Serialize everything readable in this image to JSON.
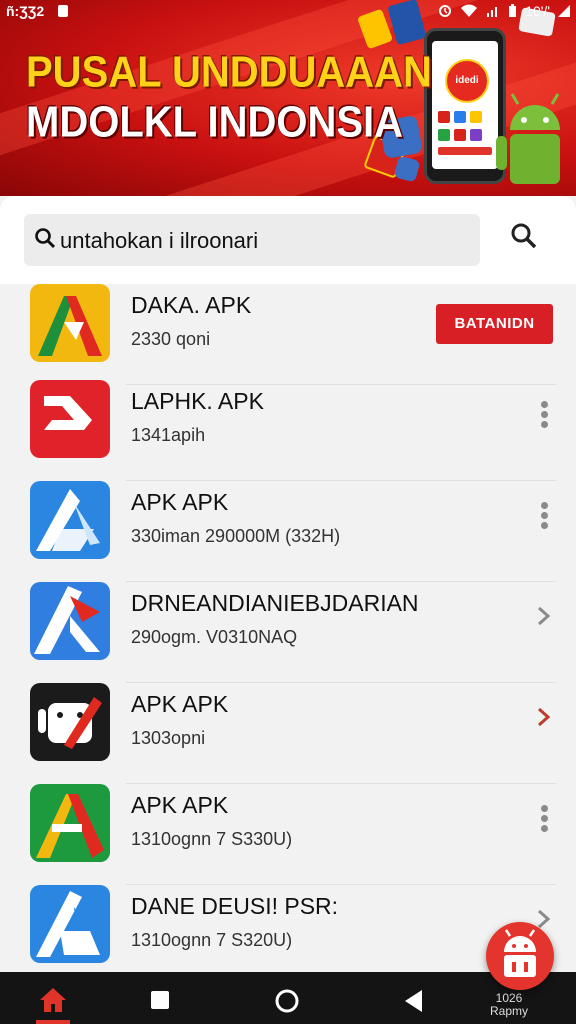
{
  "status_bar": {
    "time": "ñ:ƷƷ2",
    "battery_text": "10'/'"
  },
  "banner": {
    "line1": "PUSAL UNDDUAAAN",
    "line2": "MDOLKL INDONSIA",
    "phone_logo": "idedi"
  },
  "search": {
    "value": "untahokan i ilroonari"
  },
  "apps": [
    {
      "name": "DAKA. APK",
      "meta": "2330 qoni",
      "action": "download"
    },
    {
      "name": "LAPHK. APK",
      "meta": "1341apih",
      "action": "menu"
    },
    {
      "name": "APK APK",
      "meta": "330iman 290000M (332H)",
      "action": "menu"
    },
    {
      "name": "DRNEANDIANIEBJDARIAN",
      "meta": "290ogm. V0310NAQ",
      "action": "chevron"
    },
    {
      "name": "APK APK",
      "meta": "1303opni",
      "action": "chevron"
    },
    {
      "name": "APK APK",
      "meta": "1310ognn 7 S330U)",
      "action": "menu"
    },
    {
      "name": "DANE DEUSI! PSR:",
      "meta": "1310ognn 7 S320U)",
      "action": "chevron"
    }
  ],
  "download_label": "BATANIDN",
  "navbar": {
    "clock_line1": "1026",
    "clock_line2": "Rapmy"
  },
  "colors": {
    "accent": "#d91f26",
    "nav_bg": "#141414"
  }
}
